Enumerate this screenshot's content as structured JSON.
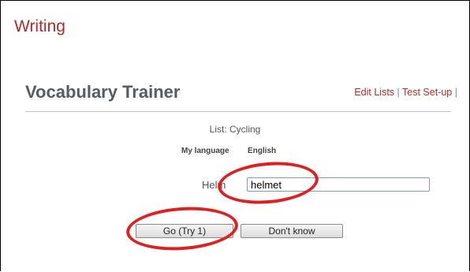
{
  "header": {
    "section_title": "Writing"
  },
  "trainer": {
    "title": "Vocabulary Trainer",
    "links": {
      "edit_lists": "Edit Lists",
      "separator": "|",
      "test_setup": "Test Set-up",
      "trailing_separator": "|"
    }
  },
  "quiz": {
    "list_label": "List: Cycling",
    "my_language_label": "My language",
    "my_language_value": "English",
    "prompt_word": "Helm",
    "answer_value": "helmet"
  },
  "buttons": {
    "go": "Go (Try 1)",
    "dont_know": "Don't know"
  },
  "annotations": {
    "highlight_color": "#e02020"
  }
}
